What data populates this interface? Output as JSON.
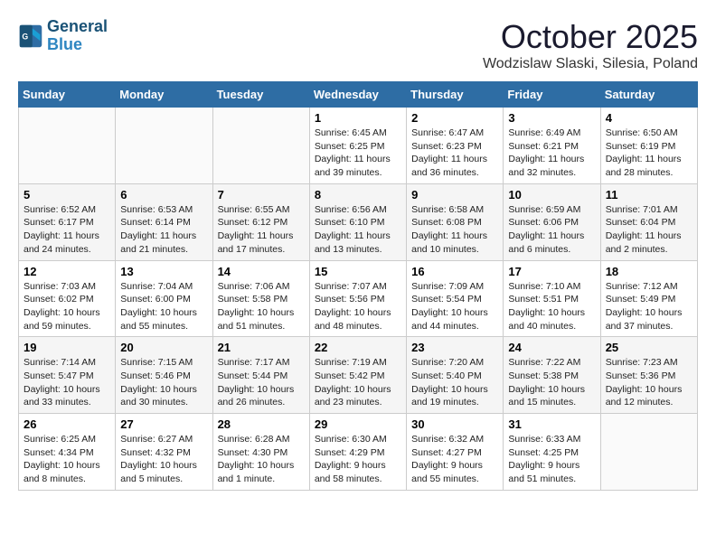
{
  "header": {
    "logo_line1": "General",
    "logo_line2": "Blue",
    "month": "October 2025",
    "location": "Wodzislaw Slaski, Silesia, Poland"
  },
  "days_of_week": [
    "Sunday",
    "Monday",
    "Tuesday",
    "Wednesday",
    "Thursday",
    "Friday",
    "Saturday"
  ],
  "weeks": [
    [
      {
        "day": "",
        "info": ""
      },
      {
        "day": "",
        "info": ""
      },
      {
        "day": "",
        "info": ""
      },
      {
        "day": "1",
        "info": "Sunrise: 6:45 AM\nSunset: 6:25 PM\nDaylight: 11 hours\nand 39 minutes."
      },
      {
        "day": "2",
        "info": "Sunrise: 6:47 AM\nSunset: 6:23 PM\nDaylight: 11 hours\nand 36 minutes."
      },
      {
        "day": "3",
        "info": "Sunrise: 6:49 AM\nSunset: 6:21 PM\nDaylight: 11 hours\nand 32 minutes."
      },
      {
        "day": "4",
        "info": "Sunrise: 6:50 AM\nSunset: 6:19 PM\nDaylight: 11 hours\nand 28 minutes."
      }
    ],
    [
      {
        "day": "5",
        "info": "Sunrise: 6:52 AM\nSunset: 6:17 PM\nDaylight: 11 hours\nand 24 minutes."
      },
      {
        "day": "6",
        "info": "Sunrise: 6:53 AM\nSunset: 6:14 PM\nDaylight: 11 hours\nand 21 minutes."
      },
      {
        "day": "7",
        "info": "Sunrise: 6:55 AM\nSunset: 6:12 PM\nDaylight: 11 hours\nand 17 minutes."
      },
      {
        "day": "8",
        "info": "Sunrise: 6:56 AM\nSunset: 6:10 PM\nDaylight: 11 hours\nand 13 minutes."
      },
      {
        "day": "9",
        "info": "Sunrise: 6:58 AM\nSunset: 6:08 PM\nDaylight: 11 hours\nand 10 minutes."
      },
      {
        "day": "10",
        "info": "Sunrise: 6:59 AM\nSunset: 6:06 PM\nDaylight: 11 hours\nand 6 minutes."
      },
      {
        "day": "11",
        "info": "Sunrise: 7:01 AM\nSunset: 6:04 PM\nDaylight: 11 hours\nand 2 minutes."
      }
    ],
    [
      {
        "day": "12",
        "info": "Sunrise: 7:03 AM\nSunset: 6:02 PM\nDaylight: 10 hours\nand 59 minutes."
      },
      {
        "day": "13",
        "info": "Sunrise: 7:04 AM\nSunset: 6:00 PM\nDaylight: 10 hours\nand 55 minutes."
      },
      {
        "day": "14",
        "info": "Sunrise: 7:06 AM\nSunset: 5:58 PM\nDaylight: 10 hours\nand 51 minutes."
      },
      {
        "day": "15",
        "info": "Sunrise: 7:07 AM\nSunset: 5:56 PM\nDaylight: 10 hours\nand 48 minutes."
      },
      {
        "day": "16",
        "info": "Sunrise: 7:09 AM\nSunset: 5:54 PM\nDaylight: 10 hours\nand 44 minutes."
      },
      {
        "day": "17",
        "info": "Sunrise: 7:10 AM\nSunset: 5:51 PM\nDaylight: 10 hours\nand 40 minutes."
      },
      {
        "day": "18",
        "info": "Sunrise: 7:12 AM\nSunset: 5:49 PM\nDaylight: 10 hours\nand 37 minutes."
      }
    ],
    [
      {
        "day": "19",
        "info": "Sunrise: 7:14 AM\nSunset: 5:47 PM\nDaylight: 10 hours\nand 33 minutes."
      },
      {
        "day": "20",
        "info": "Sunrise: 7:15 AM\nSunset: 5:46 PM\nDaylight: 10 hours\nand 30 minutes."
      },
      {
        "day": "21",
        "info": "Sunrise: 7:17 AM\nSunset: 5:44 PM\nDaylight: 10 hours\nand 26 minutes."
      },
      {
        "day": "22",
        "info": "Sunrise: 7:19 AM\nSunset: 5:42 PM\nDaylight: 10 hours\nand 23 minutes."
      },
      {
        "day": "23",
        "info": "Sunrise: 7:20 AM\nSunset: 5:40 PM\nDaylight: 10 hours\nand 19 minutes."
      },
      {
        "day": "24",
        "info": "Sunrise: 7:22 AM\nSunset: 5:38 PM\nDaylight: 10 hours\nand 15 minutes."
      },
      {
        "day": "25",
        "info": "Sunrise: 7:23 AM\nSunset: 5:36 PM\nDaylight: 10 hours\nand 12 minutes."
      }
    ],
    [
      {
        "day": "26",
        "info": "Sunrise: 6:25 AM\nSunset: 4:34 PM\nDaylight: 10 hours\nand 8 minutes."
      },
      {
        "day": "27",
        "info": "Sunrise: 6:27 AM\nSunset: 4:32 PM\nDaylight: 10 hours\nand 5 minutes."
      },
      {
        "day": "28",
        "info": "Sunrise: 6:28 AM\nSunset: 4:30 PM\nDaylight: 10 hours\nand 1 minute."
      },
      {
        "day": "29",
        "info": "Sunrise: 6:30 AM\nSunset: 4:29 PM\nDaylight: 9 hours\nand 58 minutes."
      },
      {
        "day": "30",
        "info": "Sunrise: 6:32 AM\nSunset: 4:27 PM\nDaylight: 9 hours\nand 55 minutes."
      },
      {
        "day": "31",
        "info": "Sunrise: 6:33 AM\nSunset: 4:25 PM\nDaylight: 9 hours\nand 51 minutes."
      },
      {
        "day": "",
        "info": ""
      }
    ]
  ]
}
